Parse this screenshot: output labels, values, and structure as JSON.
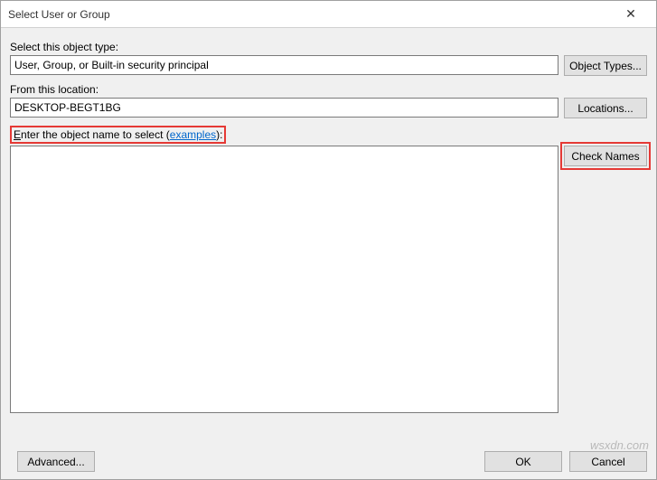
{
  "window": {
    "title": "Select User or Group",
    "close_glyph": "✕"
  },
  "object_type": {
    "label": "Select this object type:",
    "value": "User, Group, or Built-in security principal",
    "button": "Object Types..."
  },
  "location": {
    "label": "From this location:",
    "value": "DESKTOP-BEGT1BG",
    "button": "Locations..."
  },
  "object_name": {
    "label_pre": "Enter the object name to select (",
    "examples": "examples",
    "label_post": "):",
    "value": "",
    "button": "Check Names"
  },
  "footer": {
    "advanced": "Advanced...",
    "ok": "OK",
    "cancel": "Cancel"
  },
  "watermark": "wsxdn.com"
}
